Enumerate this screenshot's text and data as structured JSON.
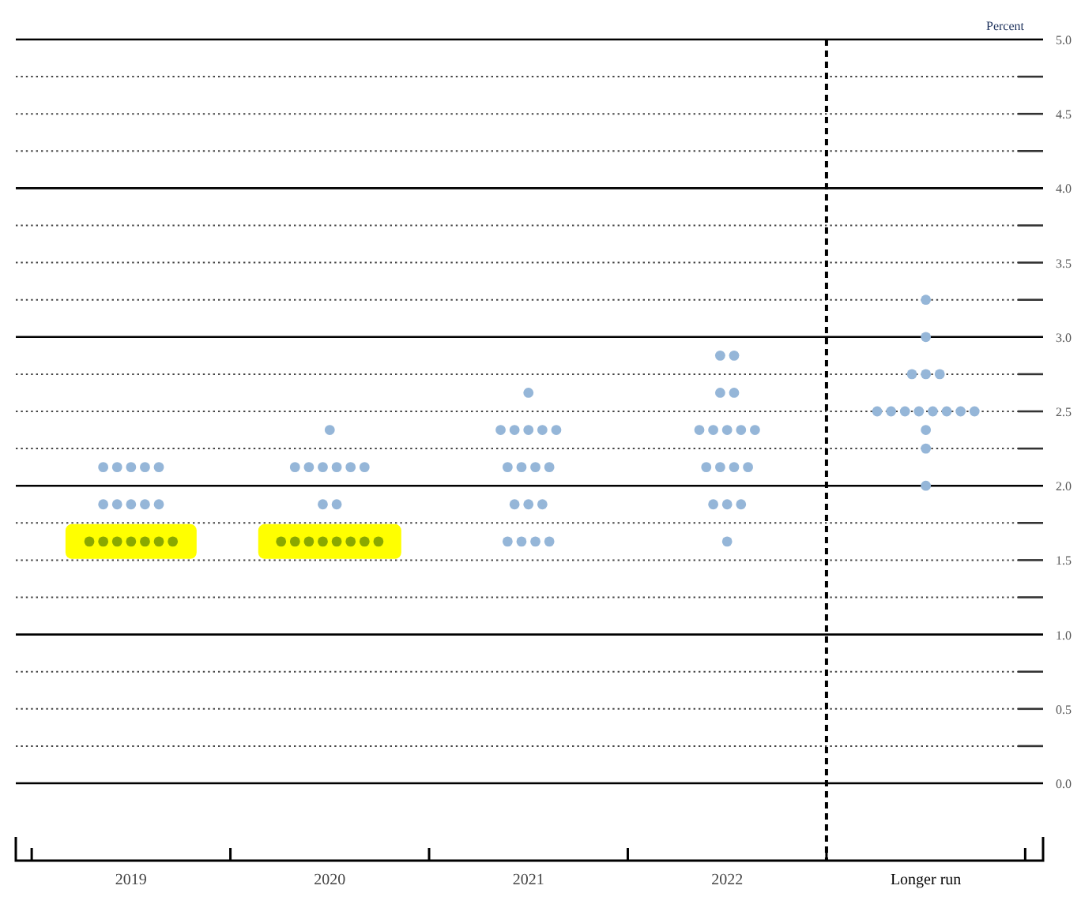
{
  "chart_data": {
    "type": "scatter",
    "ylabel": "Percent",
    "grid": true,
    "xlim": [
      2018.42,
      2023.59
    ],
    "xticks": [
      {
        "value": 2019,
        "label": "2019"
      },
      {
        "value": 2020,
        "label": "2020"
      },
      {
        "value": 2021,
        "label": "2021"
      },
      {
        "value": 2022,
        "label": "2022"
      },
      {
        "value": 2023,
        "label": "Longer run"
      }
    ],
    "ylim": [
      0,
      5
    ],
    "yticks": [
      {
        "value": 0,
        "label": "0.0"
      },
      {
        "value": 0.5,
        "label": "0.5"
      },
      {
        "value": 1,
        "label": "1.0"
      },
      {
        "value": 1.5,
        "label": "1.5"
      },
      {
        "value": 2,
        "label": "2.0"
      },
      {
        "value": 2.5,
        "label": "2.5"
      },
      {
        "value": 3,
        "label": "3.0"
      },
      {
        "value": 3.5,
        "label": "3.5"
      },
      {
        "value": 4,
        "label": "4.0"
      },
      {
        "value": 4.5,
        "label": "4.5"
      },
      {
        "value": 5,
        "label": "5.0"
      }
    ],
    "ref_lines": [
      {
        "axis": "x",
        "value": 2022.5,
        "color": "#000000"
      }
    ],
    "bands": [
      {
        "axis": "x",
        "from": 2018.67,
        "to": 2019.33,
        "color": "#ffff00"
      },
      {
        "axis": "x",
        "from": 2019.64,
        "to": 2020.36,
        "color": "#ffff00"
      }
    ],
    "series": [
      {
        "color": "#8aa800",
        "x": [
          2018.79,
          2018.86,
          2018.93,
          2019,
          2019.07,
          2019.14,
          2019.21,
          2019.755,
          2019.825,
          2019.895,
          2019.965,
          2020.035,
          2020.105,
          2020.175,
          2020.245
        ],
        "values": [
          1.625,
          1.625,
          1.625,
          1.625,
          1.625,
          1.625,
          1.625,
          1.625,
          1.625,
          1.625,
          1.625,
          1.625,
          1.625,
          1.625,
          1.625
        ]
      },
      {
        "color": "#95b6d8",
        "x": [
          2018.86,
          2018.93,
          2019,
          2019.07,
          2019.14,
          2018.86,
          2018.93,
          2019,
          2019.07,
          2019.14,
          2019.965,
          2020.035,
          2019.825,
          2019.895,
          2019.965,
          2020.035,
          2020.105,
          2020.175,
          2020,
          2020.895,
          2020.965,
          2021.035,
          2021.105,
          2020.93,
          2021,
          2021.07,
          2020.895,
          2020.965,
          2021.035,
          2021.105,
          2020.86,
          2020.93,
          2021,
          2021.07,
          2021.14,
          2021,
          2022,
          2021.93,
          2022,
          2022.07,
          2021.895,
          2021.965,
          2022.035,
          2022.105,
          2021.86,
          2021.93,
          2022,
          2022.07,
          2022.14,
          2021.965,
          2022.035,
          2021.965,
          2022.035,
          2023,
          2023,
          2023,
          2022.755,
          2022.825,
          2022.895,
          2022.965,
          2023.035,
          2023.105,
          2023.175,
          2023.245,
          2022.93,
          2023,
          2023.07,
          2023,
          2023
        ],
        "values": [
          1.875,
          1.875,
          1.875,
          1.875,
          1.875,
          2.125,
          2.125,
          2.125,
          2.125,
          2.125,
          1.875,
          1.875,
          2.125,
          2.125,
          2.125,
          2.125,
          2.125,
          2.125,
          2.375,
          1.625,
          1.625,
          1.625,
          1.625,
          1.875,
          1.875,
          1.875,
          2.125,
          2.125,
          2.125,
          2.125,
          2.375,
          2.375,
          2.375,
          2.375,
          2.375,
          2.625,
          1.625,
          1.875,
          1.875,
          1.875,
          2.125,
          2.125,
          2.125,
          2.125,
          2.375,
          2.375,
          2.375,
          2.375,
          2.375,
          2.625,
          2.625,
          2.875,
          2.875,
          2,
          2.25,
          2.375,
          2.5,
          2.5,
          2.5,
          2.5,
          2.5,
          2.5,
          2.5,
          2.5,
          2.75,
          2.75,
          2.75,
          3,
          3.25
        ]
      }
    ]
  }
}
